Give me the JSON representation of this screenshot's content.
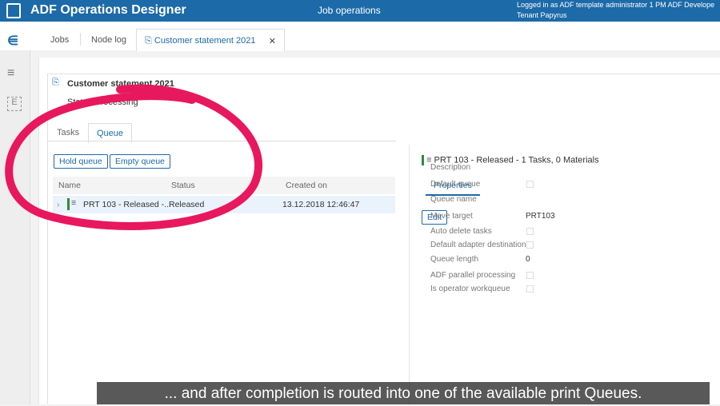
{
  "header": {
    "app_title": "ADF Operations Designer",
    "section": "Job operations",
    "logged_in": "Logged in as  ADF template administrator 1   PM ADF Develope",
    "tenant": "Tenant  Papyrus"
  },
  "tabs": [
    {
      "label": "Jobs"
    },
    {
      "label": "Node log"
    },
    {
      "label": "Customer statement 2021"
    }
  ],
  "job": {
    "title": "Customer statement 2021",
    "status": "Status  Processing"
  },
  "subtabs": [
    "Tasks",
    "Queue"
  ],
  "buttons": {
    "hold": "Hold queue",
    "empty": "Empty queue",
    "edit": "Edit"
  },
  "grid": {
    "columns": [
      "Name",
      "Status",
      "Created on"
    ],
    "rows": [
      {
        "name": "PRT 103 - Released -...",
        "status": "Released",
        "created": "13.12.2018 12:46:47"
      }
    ]
  },
  "detail": {
    "title": "PRT 103 - Released - 1 Tasks, 0 Materials",
    "tab": "Properties",
    "props": [
      {
        "label": "Description"
      },
      {
        "label": "Default queue",
        "checkbox": false
      },
      {
        "label": "Queue name"
      },
      {
        "label": "Move target",
        "value": "PRT103"
      },
      {
        "label": "Auto delete tasks",
        "checkbox": false
      },
      {
        "label": "Default adapter destination",
        "checkbox": false
      },
      {
        "label": "Queue length",
        "value": "0"
      },
      {
        "label": "ADF parallel processing",
        "checkbox": false
      },
      {
        "label": "Is operator workqueue",
        "checkbox": false
      }
    ]
  },
  "caption": "... and after completion is routed into one of the available print Queues.",
  "colors": {
    "header": "#1c6aa8",
    "annotation": "#e8185e",
    "status_green": "#2e8b3e"
  }
}
